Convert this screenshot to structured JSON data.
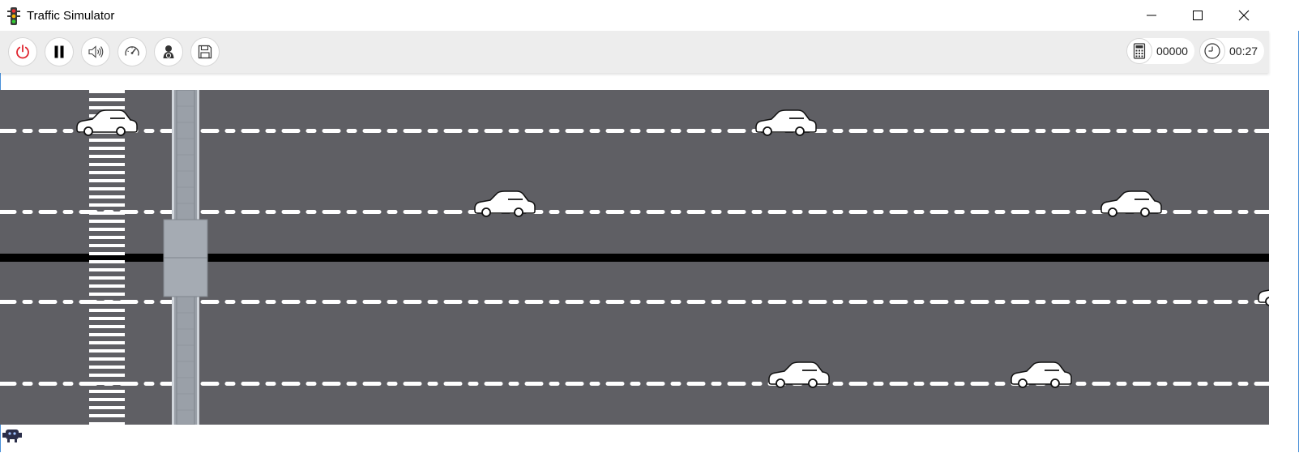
{
  "window": {
    "title": "Traffic Simulator",
    "app_icon": "traffic-light-icon",
    "controls": [
      "minimize-icon",
      "maximize-icon",
      "close-icon"
    ]
  },
  "toolbar": {
    "buttons": [
      {
        "name": "power-button",
        "icon": "power-icon",
        "color": "#e0242e"
      },
      {
        "name": "pause-button",
        "icon": "pause-icon"
      },
      {
        "name": "sound-button",
        "icon": "speaker-icon"
      },
      {
        "name": "speed-button",
        "icon": "speedometer-icon"
      },
      {
        "name": "driver-button",
        "icon": "driver-icon"
      },
      {
        "name": "save-button",
        "icon": "floppy-disk-icon"
      }
    ],
    "score": {
      "icon": "calculator-icon",
      "value": "00000"
    },
    "timer": {
      "icon": "clock-icon",
      "value": "00:27"
    }
  },
  "road": {
    "colors": {
      "asphalt": "#5f5f64",
      "lines": "#ffffff",
      "median": "#000000"
    },
    "lanes": 4,
    "cars": [
      {
        "lane": 1,
        "x_fraction": 0.059
      },
      {
        "lane": 1,
        "x_fraction": 0.594
      },
      {
        "lane": 2,
        "x_fraction": 0.372
      },
      {
        "lane": 2,
        "x_fraction": 0.866
      },
      {
        "lane": 3,
        "x_fraction": 0.99
      },
      {
        "lane": 4,
        "x_fraction": 0.604
      },
      {
        "lane": 4,
        "x_fraction": 0.795
      }
    ],
    "crosswalk_icon": "crosswalk-icon",
    "bridge_icon": "pedestrian-bridge-icon"
  },
  "statusbar": {
    "icon": "robot-icon"
  }
}
